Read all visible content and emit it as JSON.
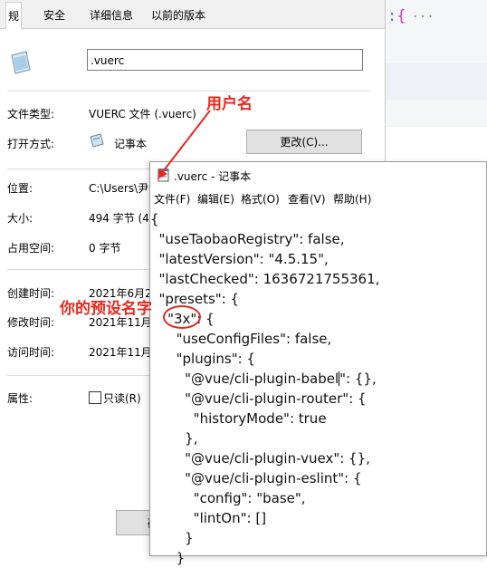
{
  "background_editor": {
    "colon": ":",
    "brace": "{",
    "ellipsis": "···"
  },
  "properties": {
    "tabs": [
      "规",
      "安全",
      "详细信息",
      "以前的版本"
    ],
    "filename": ".vuerc",
    "fields": {
      "type_label": "文件类型:",
      "type_value": "VUERC 文件 (.vuerc)",
      "open_label": "打开方式:",
      "open_value": "记事本",
      "change_button": "更改(C)...",
      "location_label": "位置:",
      "location_value": "C:\\Users\\尹",
      "size_label": "大小:",
      "size_value": "494 字节 (4",
      "disk_label": "占用空间:",
      "disk_value": "0 字节",
      "created_label": "创建时间:",
      "created_value": "2021年6月2",
      "modified_label": "修改时间:",
      "modified_value": "2021年11月",
      "accessed_label": "访问时间:",
      "accessed_value": "2021年11月",
      "attr_label": "属性:",
      "readonly_label": "只读(R)"
    },
    "bottom_button": "确"
  },
  "notepad": {
    "title": ".vuerc - 记事本",
    "menu": [
      "文件(F)",
      "编辑(E)",
      "格式(O)",
      "查看(V)",
      "帮助(H)"
    ],
    "lines": [
      "{",
      "  \"useTaobaoRegistry\": false,",
      "  \"latestVersion\": \"4.5.15\",",
      "  \"lastChecked\": 1636721755361,",
      "  \"presets\": {",
      "    \"3x\": {",
      "      \"useConfigFiles\": false,",
      "      \"plugins\": {",
      "        \"@vue/cli-plugin-babel\": {},",
      "        \"@vue/cli-plugin-router\": {",
      "          \"historyMode\": true",
      "        },",
      "        \"@vue/cli-plugin-vuex\": {},",
      "        \"@vue/cli-plugin-eslint\": {",
      "          \"config\": \"base\",",
      "          \"lintOn\": []",
      "        }",
      "      }"
    ]
  },
  "annotations": {
    "username": "用户名",
    "preset_name": "你的预设名字"
  },
  "colors": {
    "annotation": "#e8281f",
    "tab_bg": "#f0f0f0"
  }
}
